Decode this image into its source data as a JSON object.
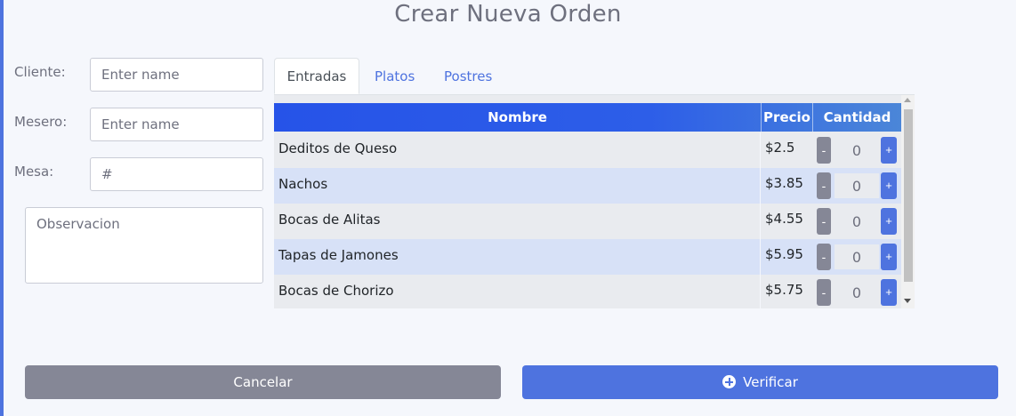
{
  "page": {
    "title": "Crear Nueva Orden"
  },
  "form": {
    "cliente": {
      "label": "Cliente:",
      "placeholder": "Enter name",
      "value": ""
    },
    "mesero": {
      "label": "Mesero:",
      "placeholder": "Enter name",
      "value": ""
    },
    "mesa": {
      "label": "Mesa:",
      "placeholder": "#",
      "value": ""
    },
    "observacion": {
      "placeholder": "Observacion",
      "value": ""
    }
  },
  "tabs": [
    {
      "label": "Entradas",
      "active": true
    },
    {
      "label": "Platos",
      "active": false
    },
    {
      "label": "Postres",
      "active": false
    }
  ],
  "table": {
    "headers": {
      "nombre": "Nombre",
      "precio": "Precio",
      "cantidad": "Cantidad"
    },
    "rows": [
      {
        "nombre": "Deditos de Queso",
        "precio": "$2.5",
        "cantidad": "0"
      },
      {
        "nombre": "Nachos",
        "precio": "$3.85",
        "cantidad": "0"
      },
      {
        "nombre": "Bocas de Alitas",
        "precio": "$4.55",
        "cantidad": "0"
      },
      {
        "nombre": "Tapas de Jamones",
        "precio": "$5.95",
        "cantidad": "0"
      },
      {
        "nombre": "Bocas de Chorizo",
        "precio": "$5.75",
        "cantidad": "0"
      }
    ],
    "minus_label": "-",
    "plus_label": "+"
  },
  "actions": {
    "cancel_label": "Cancelar",
    "verify_label": "Verificar"
  },
  "colors": {
    "primary": "#4e73df",
    "secondary": "#858796",
    "header_gradient_start": "#2653e8",
    "header_gradient_end": "#4b86d8"
  }
}
